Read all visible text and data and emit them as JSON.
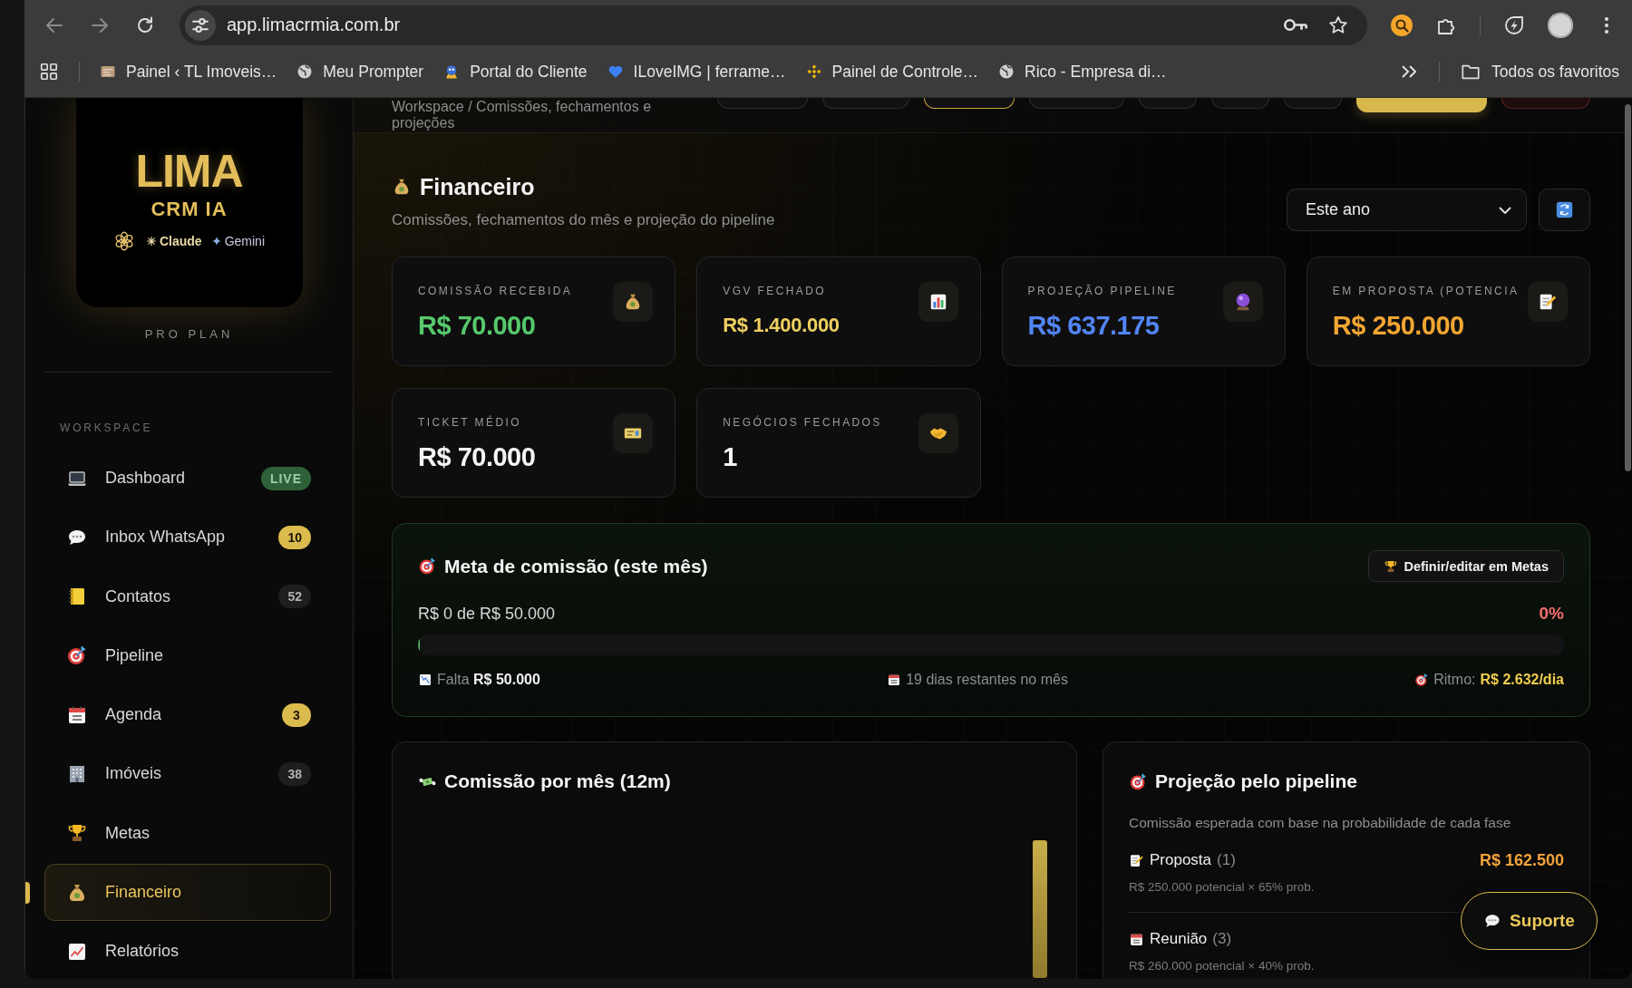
{
  "browser": {
    "address": "app.limacrmia.com.br",
    "bookmarks": [
      {
        "label": "Painel ‹ TL Imoveis…"
      },
      {
        "label": "Meu Prompter"
      },
      {
        "label": "Portal do Cliente"
      },
      {
        "label": "ILoveIMG | ferrame…"
      },
      {
        "label": "Painel de Controle…"
      },
      {
        "label": "Rico - Empresa di…"
      }
    ],
    "all_bookmarks": "Todos os favoritos"
  },
  "sidebar": {
    "logo": {
      "wordmark": "LIMA",
      "subtitle": "CRM IA",
      "partners": [
        "Claude",
        "Gemini"
      ]
    },
    "plan": "PRO PLAN",
    "section": "WORKSPACE",
    "items": [
      {
        "label": "Dashboard",
        "badge": {
          "text": "LIVE",
          "kind": "live"
        },
        "selected": false
      },
      {
        "label": "Inbox WhatsApp",
        "badge": {
          "text": "10",
          "kind": "accent"
        },
        "selected": false
      },
      {
        "label": "Contatos",
        "badge": {
          "text": "52",
          "kind": "neutral"
        },
        "selected": false
      },
      {
        "label": "Pipeline",
        "selected": false
      },
      {
        "label": "Agenda",
        "badge": {
          "text": "3",
          "kind": "accent"
        },
        "selected": false
      },
      {
        "label": "Imóveis",
        "badge": {
          "text": "38",
          "kind": "neutral"
        },
        "selected": false
      },
      {
        "label": "Metas",
        "selected": false
      },
      {
        "label": "Financeiro",
        "selected": true
      },
      {
        "label": "Relatórios",
        "selected": false
      }
    ]
  },
  "header": {
    "breadcrumb": "Workspace / Comissões, fechamentos e projeções",
    "buttons": [
      {
        "kind": "default"
      },
      {
        "kind": "default"
      },
      {
        "kind": "current"
      },
      {
        "kind": "default"
      },
      {
        "kind": "default"
      },
      {
        "kind": "default"
      },
      {
        "kind": "default"
      },
      {
        "kind": "primary"
      },
      {
        "kind": "danger"
      }
    ]
  },
  "page": {
    "title": "Financeiro",
    "subtitle": "Comissões, fechamentos do mês e projeção do pipeline",
    "period": "Este ano"
  },
  "kpis": [
    {
      "label": "COMISSÃO RECEBIDA",
      "value": "R$ 70.000",
      "color": "#56c96b",
      "kind": "large"
    },
    {
      "label": "VGV FECHADO",
      "value": "R$ 1.400.000",
      "color": "#f0d060",
      "kind": "compact"
    },
    {
      "label": "PROJEÇÃO PIPELINE",
      "value": "R$ 637.175",
      "color": "#5285f5",
      "kind": "large"
    },
    {
      "label": "EM PROPOSTA (POTENCIA",
      "value": "R$ 250.000",
      "color": "#f2a632",
      "kind": "large"
    },
    {
      "label": "TICKET MÉDIO",
      "value": "R$ 70.000",
      "color": "#f5f5f5",
      "kind": "large"
    },
    {
      "label": "NEGÓCIOS FECHADOS",
      "value": "1",
      "color": "#f5f5f5",
      "kind": "large"
    }
  ],
  "goal": {
    "title": "Meta de comissão (este mês)",
    "button": "Definir/editar em Metas",
    "progress_text": "R$ 0 de R$ 50.000",
    "percent": "0%",
    "level": 0,
    "remaining": "Falta **R$ 50.000**",
    "days_left": "19 dias restantes no mês",
    "pace_label": "Ritmo:",
    "pace_value": "R$ 2.632/dia"
  },
  "monthly_chart": {
    "title": "Comissão por mês (12m)"
  },
  "projection": {
    "title": "Projeção pelo pipeline",
    "subtitle": "Comissão esperada com base na probabilidade de cada fase",
    "stages": [
      {
        "name": "Proposta",
        "count": "(1)",
        "value": "R$ 162.500",
        "detail": "R$ 250.000 potencial × 65% prob."
      },
      {
        "name": "Reunião",
        "count": "(3)",
        "detail": "R$ 260.000 potencial × 40% prob."
      }
    ]
  },
  "support_button": "Suporte"
}
